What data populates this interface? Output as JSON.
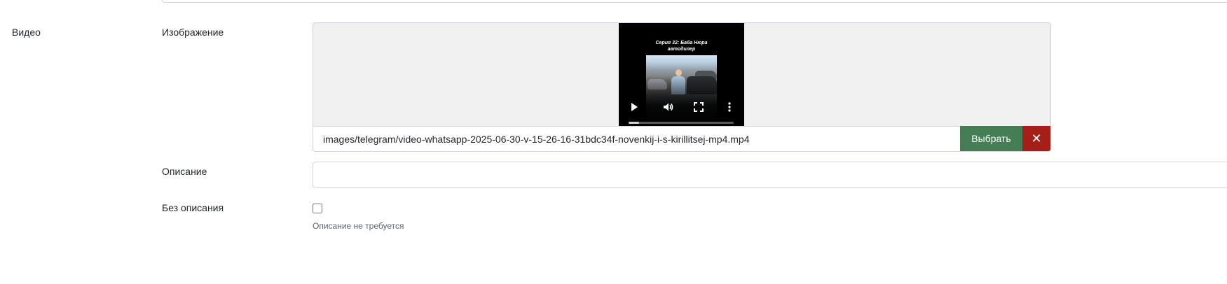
{
  "section": {
    "label": "Видео"
  },
  "image_field": {
    "label": "Изображение",
    "path_value": "images/telegram/video-whatsapp-2025-06-30-v-15-26-16-31bdc34f-novenkij-i-s-kirillitsej-mp4.mp4",
    "select_label": "Выбрать",
    "clear_symbol": "✕",
    "video": {
      "caption_line1": "Серия 32: Баба Нюра",
      "caption_line2": "автодилер",
      "progress": 0.1,
      "controls": [
        "play-icon",
        "volume-icon",
        "fullscreen-icon",
        "more-options-icon"
      ]
    }
  },
  "description_field": {
    "label": "Описание",
    "value": ""
  },
  "no_description_field": {
    "label": "Без описания",
    "checked": false,
    "help_text": "Описание не требуется"
  },
  "colors": {
    "select_button": "#457d54",
    "clear_button": "#a51f18",
    "preview_background": "#f0f0f0",
    "border": "#ced4da"
  }
}
